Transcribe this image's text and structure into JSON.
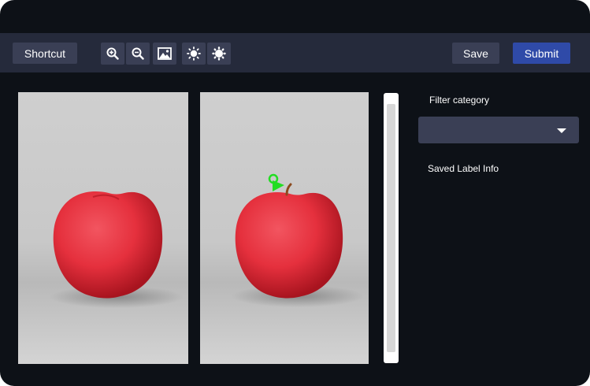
{
  "toolbar": {
    "shortcut_label": "Shortcut",
    "save_label": "Save",
    "submit_label": "Submit",
    "tools": [
      "zoom-in-icon",
      "zoom-out-icon",
      "image-icon",
      "brightness-up-icon",
      "brightness-down-icon"
    ]
  },
  "sidebar": {
    "filter_label": "Filter category",
    "filter_value": "",
    "saved_info_label": "Saved Label Info"
  },
  "colors": {
    "background": "#0d1117",
    "toolbar": "#252a3b",
    "button": "#3a3f55",
    "submit": "#2f4aa8",
    "marker": "#22dd22"
  }
}
